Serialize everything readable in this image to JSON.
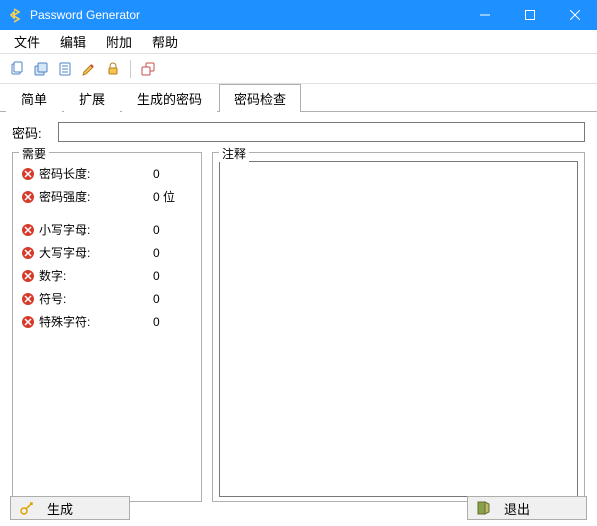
{
  "window": {
    "title": "Password Generator"
  },
  "menu": {
    "file": "文件",
    "edit": "编辑",
    "extra": "附加",
    "help": "帮助"
  },
  "tabs": {
    "simple": "简单",
    "extended": "扩展",
    "generated": "生成的密码",
    "check": "密码检查"
  },
  "password": {
    "label": "密码:",
    "value": ""
  },
  "requirements": {
    "title": "需要",
    "length": {
      "label": "密码长度:",
      "value": "0"
    },
    "strength": {
      "label": "密码强度:",
      "value": "0 位"
    },
    "lower": {
      "label": "小写字母:",
      "value": "0"
    },
    "upper": {
      "label": "大写字母:",
      "value": "0"
    },
    "digits": {
      "label": "数字:",
      "value": "0"
    },
    "symbols": {
      "label": "符号:",
      "value": "0"
    },
    "special": {
      "label": "特殊字符:",
      "value": "0"
    }
  },
  "notes": {
    "title": "注释"
  },
  "footer": {
    "generate": "生成",
    "exit": "退出"
  }
}
